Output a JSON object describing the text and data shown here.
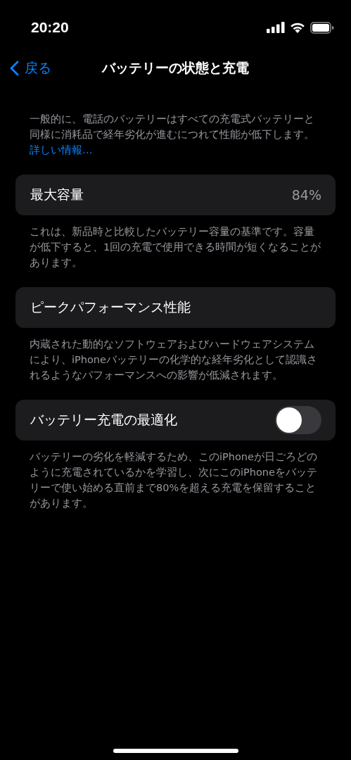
{
  "status_bar": {
    "time": "20:20"
  },
  "nav": {
    "back": "戻る",
    "title": "バッテリーの状態と充電"
  },
  "intro": {
    "text": "一般的に、電話のバッテリーはすべての充電式バッテリーと同様に消耗品で経年劣化が進むにつれて性能が低下します。",
    "link": "詳しい情報…"
  },
  "sections": [
    {
      "kind": "value",
      "label": "最大容量",
      "value": "84%",
      "footer": "これは、新品時と比較したバッテリー容量の基準です。容量が低下すると、1回の充電で使用できる時間が短くなることがあります。"
    },
    {
      "kind": "plain",
      "label": "ピークパフォーマンス性能",
      "footer": "内蔵された動的なソフトウェアおよびハードウェアシステムにより、iPhoneバッテリーの化学的な経年劣化として認識されるようなパフォーマンスへの影響が低減されます。"
    },
    {
      "kind": "toggle",
      "label": "バッテリー充電の最適化",
      "on": false,
      "footer": "バッテリーの劣化を軽減するため、このiPhoneが日ごろどのように充電されているかを学習し、次にこのiPhoneをバッテリーで使い始める直前まで80%を超える充電を保留することがあります。"
    }
  ]
}
